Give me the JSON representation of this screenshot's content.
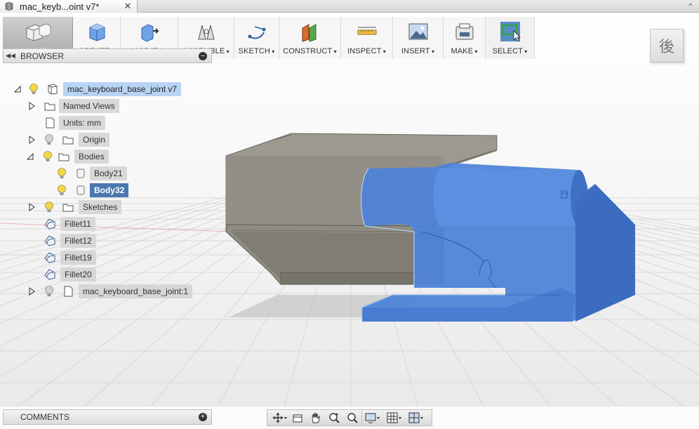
{
  "tab": {
    "title": "mac_keyb...oint v7*",
    "close": "✕",
    "doc_icon": "document-icon"
  },
  "window": {
    "collapse": "⌃"
  },
  "toolbar": {
    "groups": [
      {
        "id": "model",
        "label": "MODEL",
        "icon": "model-icon"
      },
      {
        "id": "create",
        "label": "CREATE",
        "icon": "cube-icon"
      },
      {
        "id": "modify",
        "label": "MODIFY",
        "icon": "modify-icon"
      },
      {
        "id": "assemble",
        "label": "ASSEMBLE",
        "icon": "assemble-icon"
      },
      {
        "id": "sketch",
        "label": "SKETCH",
        "icon": "sketch-icon"
      },
      {
        "id": "construct",
        "label": "CONSTRUCT",
        "icon": "construct-icon"
      },
      {
        "id": "inspect",
        "label": "INSPECT",
        "icon": "ruler-icon"
      },
      {
        "id": "insert",
        "label": "INSERT",
        "icon": "image-icon"
      },
      {
        "id": "make",
        "label": "MAKE",
        "icon": "printer-icon"
      },
      {
        "id": "select",
        "label": "SELECT",
        "icon": "select-icon"
      }
    ]
  },
  "viewcube": {
    "face_label": "後"
  },
  "browser": {
    "title": "BROWSER",
    "back": "◀◀",
    "minimize": "–",
    "nodes": [
      {
        "label": "mac_keyboard_base_joint v7"
      },
      {
        "label": "Named Views"
      },
      {
        "label": "Units: mm"
      },
      {
        "label": "Origin"
      },
      {
        "label": "Bodies"
      },
      {
        "label": "Body21"
      },
      {
        "label": "Body32"
      },
      {
        "label": "Sketches"
      },
      {
        "label": "Fillet11"
      },
      {
        "label": "Fillet12"
      },
      {
        "label": "Fillet19"
      },
      {
        "label": "Fillet20"
      },
      {
        "label": "mac_keyboard_base_joint:1"
      }
    ]
  },
  "comments": {
    "title": "COMMENTS",
    "add": "+"
  },
  "colors": {
    "accent_blue": "#4a78ae",
    "body_blue": "#4a7fd6",
    "body_gray": "#8c8a82",
    "grid": "#cfcfcf"
  },
  "navbar": {
    "tools": [
      "orbit-icon",
      "look-at-icon",
      "pan-icon",
      "zoom-icon",
      "fit-icon",
      "display-settings-icon",
      "grid-icon",
      "viewports-icon"
    ]
  }
}
